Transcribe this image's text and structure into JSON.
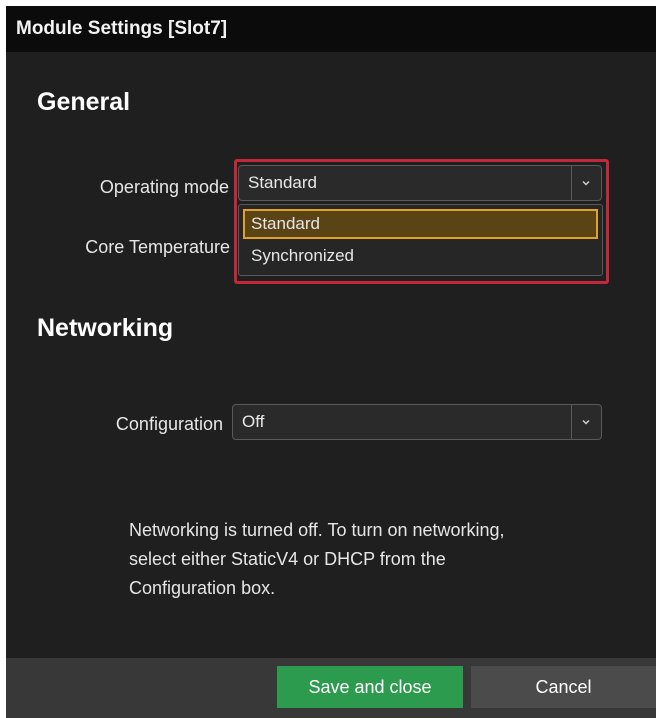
{
  "dialog": {
    "title": "Module Settings [Slot7]"
  },
  "general": {
    "heading": "General",
    "operating_mode": {
      "label": "Operating mode",
      "value": "Standard",
      "options": [
        "Standard",
        "Synchronized"
      ],
      "selected_option": "Standard"
    },
    "core_temperature": {
      "label": "Core Temperature"
    }
  },
  "networking": {
    "heading": "Networking",
    "configuration": {
      "label": "Configuration",
      "value": "Off"
    },
    "info_lines": [
      "Networking is turned off. To turn on networking,",
      "select either StaticV4 or DHCP from the",
      "Configuration box."
    ]
  },
  "footer": {
    "save_label": "Save and close",
    "cancel_label": "Cancel"
  },
  "icons": {
    "dropdown": "chevron-down-icon"
  },
  "colors": {
    "background": "#1f1f1f",
    "titlebar": "#0b0b0b",
    "highlight_border": "#c3273a",
    "selected_option_border": "#e0a126",
    "selected_option_fill": "#5a4314",
    "save_button": "#2c9b4d",
    "cancel_button": "#4b4b4b"
  }
}
